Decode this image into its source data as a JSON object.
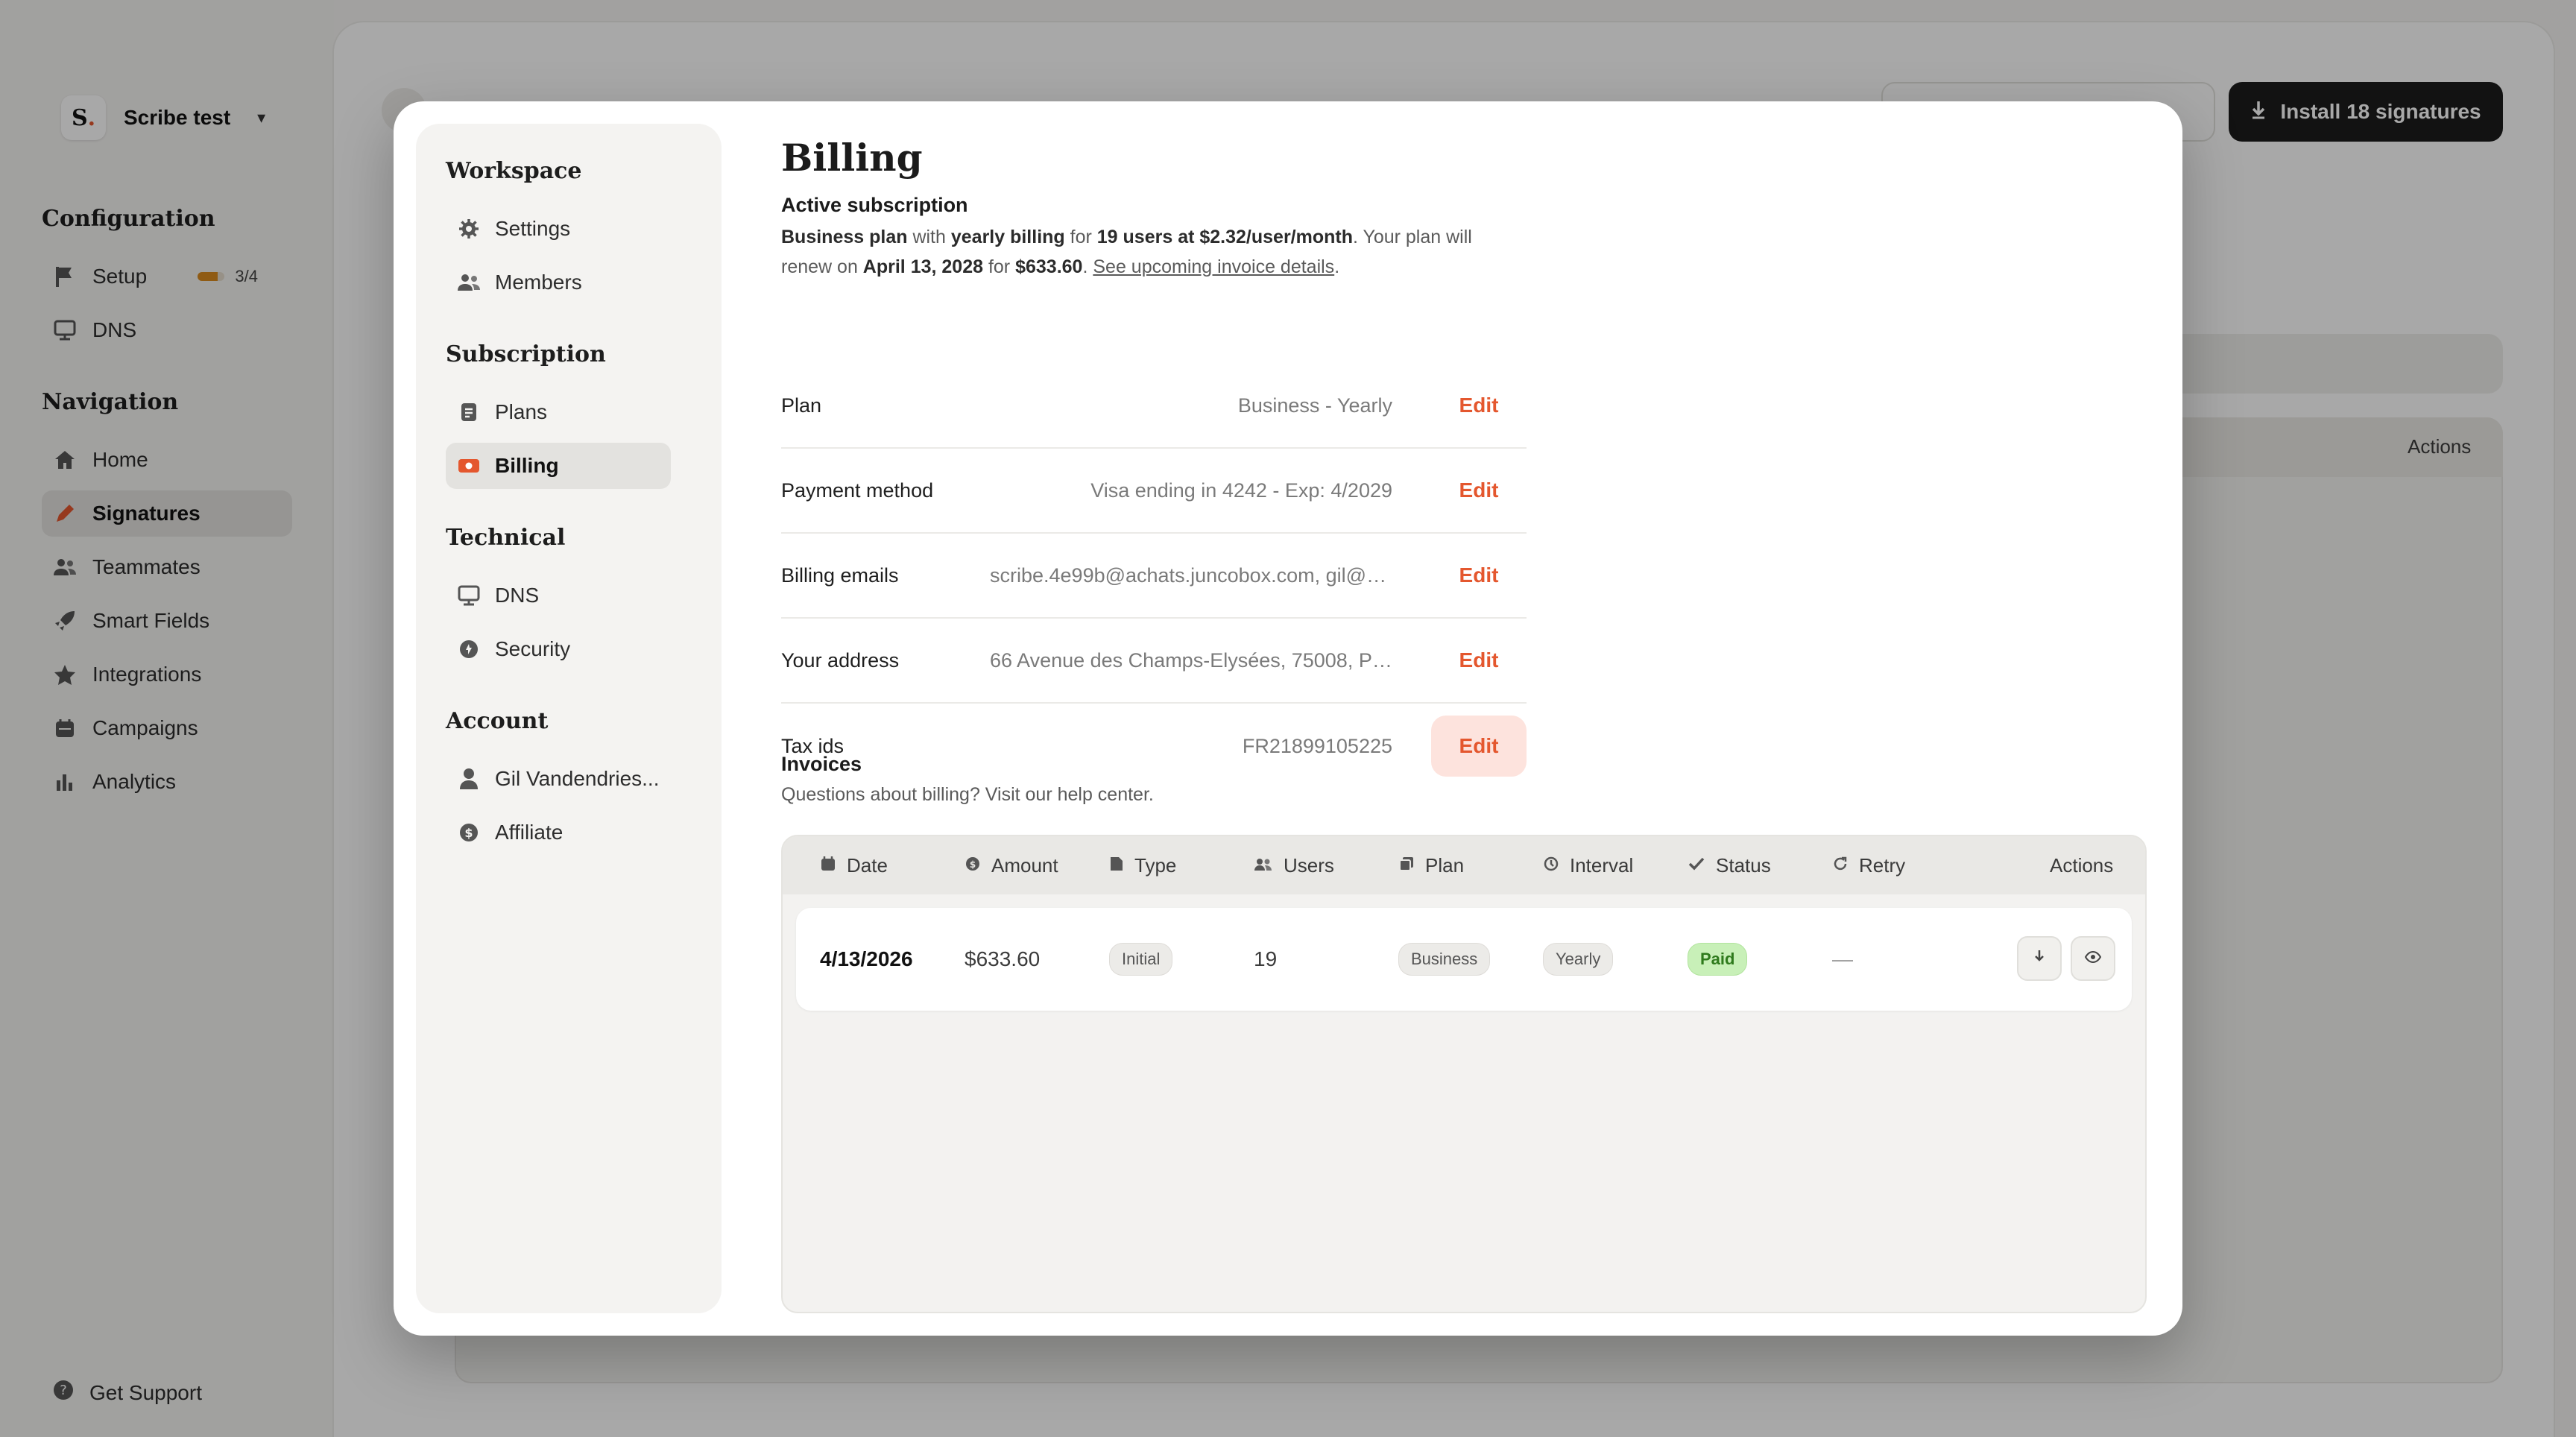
{
  "workspace": {
    "logo_text": "S.",
    "name": "Scribe test"
  },
  "sidebar": {
    "configuration_heading": "Configuration",
    "configuration_items": [
      {
        "label": "Setup",
        "icon": "flag-icon",
        "progress_text": "3/4",
        "progress_fraction": 0.75
      },
      {
        "label": "DNS",
        "icon": "dns-icon"
      }
    ],
    "navigation_heading": "Navigation",
    "navigation_items": [
      {
        "label": "Home",
        "icon": "home-icon"
      },
      {
        "label": "Signatures",
        "icon": "pen-icon",
        "active": true
      },
      {
        "label": "Teammates",
        "icon": "users-icon"
      },
      {
        "label": "Smart Fields",
        "icon": "rocket-icon"
      },
      {
        "label": "Integrations",
        "icon": "star-icon"
      },
      {
        "label": "Campaigns",
        "icon": "calendar-icon"
      },
      {
        "label": "Analytics",
        "icon": "bar-chart-icon"
      }
    ],
    "support_label": "Get Support"
  },
  "header": {
    "install_button_label": "Install 18 signatures",
    "actions_label": "Actions"
  },
  "settings_nav": {
    "sections": [
      {
        "heading": "Workspace",
        "items": [
          {
            "label": "Settings",
            "icon": "gear-icon"
          },
          {
            "label": "Members",
            "icon": "users-icon"
          }
        ]
      },
      {
        "heading": "Subscription",
        "items": [
          {
            "label": "Plans",
            "icon": "document-icon"
          },
          {
            "label": "Billing",
            "icon": "billing-icon",
            "active": true
          }
        ]
      },
      {
        "heading": "Technical",
        "items": [
          {
            "label": "DNS",
            "icon": "dns-icon"
          },
          {
            "label": "Security",
            "icon": "shield-icon"
          }
        ]
      },
      {
        "heading": "Account",
        "items": [
          {
            "label": "Gil Vandendries...",
            "icon": "user-icon"
          },
          {
            "label": "Affiliate",
            "icon": "coin-icon"
          }
        ]
      }
    ]
  },
  "billing": {
    "title": "Billing",
    "subscription_heading": "Active subscription",
    "desc": {
      "plan": "Business plan",
      "t1": " with ",
      "billing": "yearly billing",
      "t2": " for ",
      "users": "19 users at $2.32/user/month",
      "t3": ". Your plan will renew on ",
      "date": "April 13, 2028",
      "t4": " for ",
      "amount": "$633.60",
      "t5": ". ",
      "link": "See upcoming invoice details",
      "t6": "."
    },
    "fields": [
      {
        "label": "Plan",
        "value": "Business - Yearly",
        "action": "Edit"
      },
      {
        "label": "Payment method",
        "value": "Visa ending in 4242 - Exp: 4/2029",
        "action": "Edit"
      },
      {
        "label": "Billing emails",
        "value": "scribe.4e99b@achats.juncobox.com, gil@s...",
        "action": "Edit"
      },
      {
        "label": "Your address",
        "value": "66 Avenue des Champs-Elysées, 75008, Pa...",
        "action": "Edit"
      },
      {
        "label": "Tax ids",
        "value": "FR21899105225",
        "action": "Edit"
      }
    ],
    "invoices_heading": "Invoices",
    "invoices_desc": "Questions about billing? Visit our help center.",
    "invoice_columns": [
      {
        "label": "Date",
        "icon": "calendar-icon"
      },
      {
        "label": "Amount",
        "icon": "coin-icon"
      },
      {
        "label": "Type",
        "icon": "document-icon"
      },
      {
        "label": "Users",
        "icon": "users-icon"
      },
      {
        "label": "Plan",
        "icon": "copy-icon"
      },
      {
        "label": "Interval",
        "icon": "clock-icon"
      },
      {
        "label": "Status",
        "icon": "check-icon"
      },
      {
        "label": "Retry",
        "icon": "refresh-icon"
      },
      {
        "label": "Actions"
      }
    ],
    "invoices": [
      {
        "date": "4/13/2026",
        "amount": "$633.60",
        "type": "Initial",
        "users": "19",
        "plan": "Business",
        "interval": "Yearly",
        "status": "Paid",
        "retry": "—"
      }
    ]
  },
  "colors": {
    "accent": "#e4572e",
    "paid_bg": "#c8f0b8",
    "dark_button": "#1c1c1c"
  }
}
